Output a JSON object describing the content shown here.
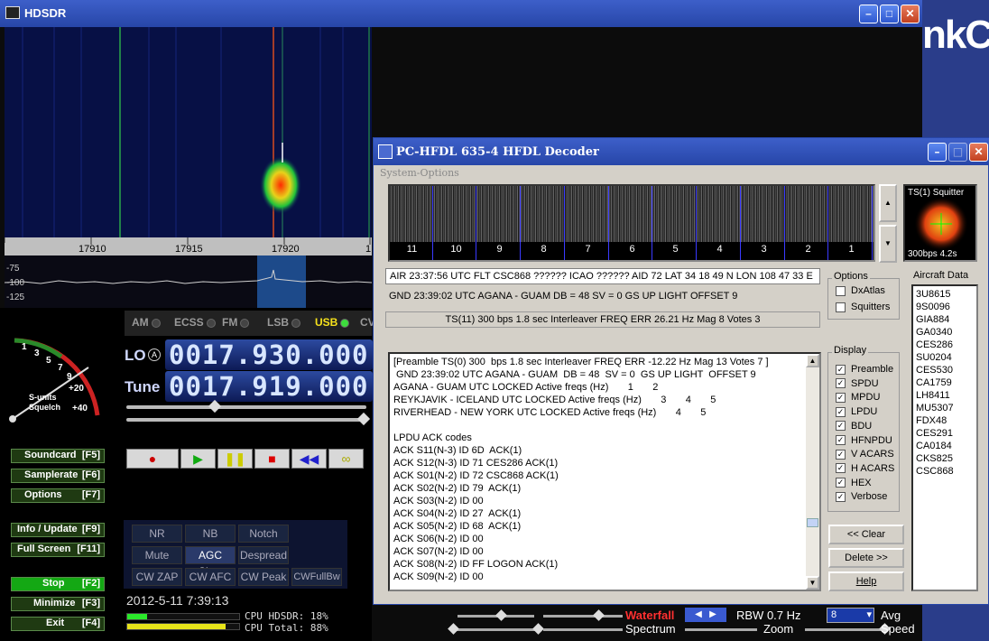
{
  "hdsdr": {
    "title": "HDSDR",
    "freq_ticks": [
      "17910",
      "17915",
      "17920",
      "1"
    ],
    "db_ticks": [
      "-75",
      "-100",
      "-125"
    ],
    "modes": [
      {
        "label": "AM",
        "active": false
      },
      {
        "label": "ECSS",
        "active": false
      },
      {
        "label": "FM",
        "active": false
      },
      {
        "label": "LSB",
        "active": false
      },
      {
        "label": "USB",
        "active": true
      },
      {
        "label": "CV",
        "active": false
      }
    ],
    "lo_label": "LO",
    "lo_badge": "A",
    "lo_freq": "0017.930.000",
    "tune_label": "Tune",
    "tune_freq": "0017.919.000",
    "smeter_ticks": [
      "1",
      "3",
      "5",
      "7",
      "9",
      "+20",
      "+40"
    ],
    "smeter_label_1": "S-units",
    "smeter_label_2": "Squelch",
    "side_buttons": [
      "Soundcard",
      "Samplerate",
      "Options",
      "Info / Update",
      "Full Screen",
      "Stop",
      "Minimize",
      "Exit"
    ],
    "side_keys": [
      "[F5]",
      "[F6]",
      "[F7]",
      "[F9]",
      "[F11]",
      "[F2]",
      "[F3]",
      "[F4]"
    ],
    "filter_buttons": [
      "NR",
      "NB",
      "Notch",
      "Mute",
      "AGC Slow",
      "Despread",
      "CW ZAP",
      "CW AFC",
      "CW Peak",
      "CWFullBw"
    ],
    "datetime": "2012-5-11 7:39:13",
    "cpu_hdsdr_label": "CPU HDSDR: 18%",
    "cpu_total_label": "CPU Total: 88%",
    "cpu_hdsdr": 0.18,
    "cpu_total": 0.88,
    "waterfall_label": "Waterfall",
    "spectrum_label": "Spectrum",
    "rbw_label": "RBW  0.7 Hz",
    "zoom_label": "Zoom",
    "avg_value": "8",
    "avg_label": "Avg",
    "speed_label": "Speed"
  },
  "hfdl": {
    "title": "PC-HFDL 635-4 HFDL Decoder",
    "menu": "System-Options",
    "slots": [
      "11",
      "10",
      "9",
      "8",
      "7",
      "6",
      "5",
      "4",
      "3",
      "2",
      "1"
    ],
    "squitter_title": "TS(1) Squitter",
    "squitter_caption": "300bps 4.2s",
    "line_air": "AIR 23:37:56  UTC FLT CSC868 ?????? ICAO ?????? AID 72 LAT 34 18 49  N  LON 108 47 33  E",
    "line_gnd": "GND 23:39:02 UTC AGANA - GUAM  DB = 48  SV = 0  GS UP LIGHT  OFFSET 9",
    "line_ts": "TS(11) 300  bps 1.8 sec Interleaver FREQ ERR 26.21 Hz Mag 8 Votes 3",
    "log": [
      "[Preamble TS(0) 300  bps 1.8 sec Interleaver FREQ ERR -12.22 Hz Mag 13 Votes 7 ]",
      " GND 23:39:02 UTC AGANA - GUAM  DB = 48  SV = 0  GS UP LIGHT  OFFSET 9",
      "AGANA - GUAM UTC LOCKED Active freqs (Hz)       1       2",
      "REYKJAVIK - ICELAND UTC LOCKED Active freqs (Hz)       3       4       5",
      "RIVERHEAD - NEW YORK UTC LOCKED Active freqs (Hz)       4       5",
      "",
      "LPDU ACK codes",
      "ACK S11(N-3) ID 6D  ACK(1)",
      "ACK S12(N-3) ID 71 CES286 ACK(1)",
      "ACK S01(N-2) ID 72 CSC868 ACK(1)",
      "ACK S02(N-2) ID 79  ACK(1)",
      "ACK S03(N-2) ID 00",
      "ACK S04(N-2) ID 27  ACK(1)",
      "ACK S05(N-2) ID 68  ACK(1)",
      "ACK S06(N-2) ID 00",
      "ACK S07(N-2) ID 00",
      "ACK S08(N-2) ID FF LOGON ACK(1)",
      "ACK S09(N-2) ID 00"
    ],
    "options_title": "Options",
    "options": [
      {
        "label": "DxAtlas",
        "checked": false
      },
      {
        "label": "Squitters",
        "checked": false
      }
    ],
    "display_title": "Display",
    "display": [
      {
        "label": "Preamble",
        "checked": true
      },
      {
        "label": "SPDU",
        "checked": true
      },
      {
        "label": "MPDU",
        "checked": true
      },
      {
        "label": "LPDU",
        "checked": true
      },
      {
        "label": "BDU",
        "checked": true
      },
      {
        "label": "HFNPDU",
        "checked": true
      },
      {
        "label": "V ACARS",
        "checked": true
      },
      {
        "label": "H ACARS",
        "checked": true
      },
      {
        "label": "HEX",
        "checked": true
      },
      {
        "label": "Verbose",
        "checked": true
      }
    ],
    "clear_label": "<< Clear",
    "delete_label": "Delete >>",
    "help_label": "Help",
    "aircraft_title": "Aircraft Data",
    "aircraft": [
      "3U8615",
      "9S0096",
      "GIA884",
      "GA0340",
      "CES286",
      "SU0204",
      "CES530",
      "CA1759",
      "LH8411",
      "MU5307",
      "FDX48",
      "CES291",
      "CA0184",
      "CKS825",
      "CSC868"
    ]
  },
  "desktop_text": "nkCe"
}
